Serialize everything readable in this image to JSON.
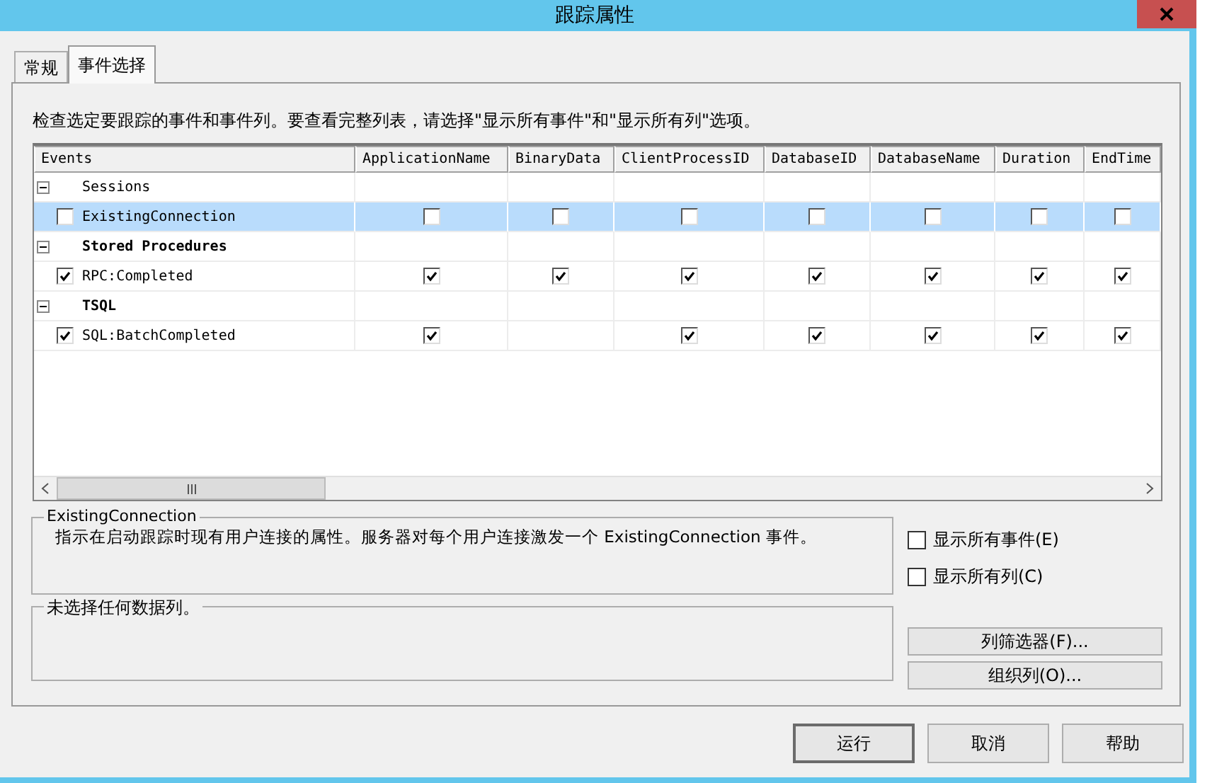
{
  "window": {
    "title": "跟踪属性"
  },
  "tabs": [
    {
      "label": "常规",
      "selected": false
    },
    {
      "label": "事件选择",
      "selected": true
    }
  ],
  "description": "检查选定要跟踪的事件和事件列。要查看完整列表，请选择\"显示所有事件\"和\"显示所有列\"选项。",
  "grid": {
    "columns": [
      "Events",
      "ApplicationName",
      "BinaryData",
      "ClientProcessID",
      "DatabaseID",
      "DatabaseName",
      "Duration",
      "EndTime"
    ],
    "rows": [
      {
        "kind": "group",
        "label": "Sessions",
        "bold": false,
        "expanded": true
      },
      {
        "kind": "event",
        "label": "ExistingConnection",
        "checked": false,
        "selected": true,
        "cells": [
          {
            "kind": "checkbox",
            "checked": false
          },
          {
            "kind": "checkbox",
            "checked": false
          },
          {
            "kind": "checkbox",
            "checked": false
          },
          {
            "kind": "checkbox",
            "checked": false
          },
          {
            "kind": "checkbox",
            "checked": false
          },
          {
            "kind": "checkbox",
            "checked": false
          },
          {
            "kind": "checkbox",
            "checked": false
          }
        ]
      },
      {
        "kind": "group",
        "label": "Stored Procedures",
        "bold": true,
        "expanded": true
      },
      {
        "kind": "event",
        "label": "RPC:Completed",
        "checked": true,
        "selected": false,
        "cells": [
          {
            "kind": "checkbox",
            "checked": true
          },
          {
            "kind": "checkbox",
            "checked": true
          },
          {
            "kind": "checkbox",
            "checked": true
          },
          {
            "kind": "checkbox",
            "checked": true
          },
          {
            "kind": "checkbox",
            "checked": true
          },
          {
            "kind": "checkbox",
            "checked": true
          },
          {
            "kind": "checkbox",
            "checked": true
          }
        ]
      },
      {
        "kind": "group",
        "label": "TSQL",
        "bold": true,
        "expanded": true
      },
      {
        "kind": "event",
        "label": "SQL:BatchCompleted",
        "checked": true,
        "selected": false,
        "cells": [
          {
            "kind": "checkbox",
            "checked": true
          },
          {
            "kind": "blank"
          },
          {
            "kind": "checkbox",
            "checked": true
          },
          {
            "kind": "checkbox",
            "checked": true
          },
          {
            "kind": "checkbox",
            "checked": true
          },
          {
            "kind": "checkbox",
            "checked": true
          },
          {
            "kind": "checkbox",
            "checked": true
          }
        ]
      }
    ]
  },
  "event_info": {
    "title": "ExistingConnection",
    "text": "指示在启动跟踪时现有用户连接的属性。服务器对每个用户连接激发一个 ExistingConnection 事件。"
  },
  "options": [
    {
      "label": "显示所有事件(E)",
      "checked": false
    },
    {
      "label": "显示所有列(C)",
      "checked": false
    }
  ],
  "column_info": {
    "title": "未选择任何数据列。"
  },
  "side_buttons": [
    "列筛选器(F)...",
    "组织列(O)..."
  ],
  "buttons": [
    "运行",
    "取消",
    "帮助"
  ]
}
